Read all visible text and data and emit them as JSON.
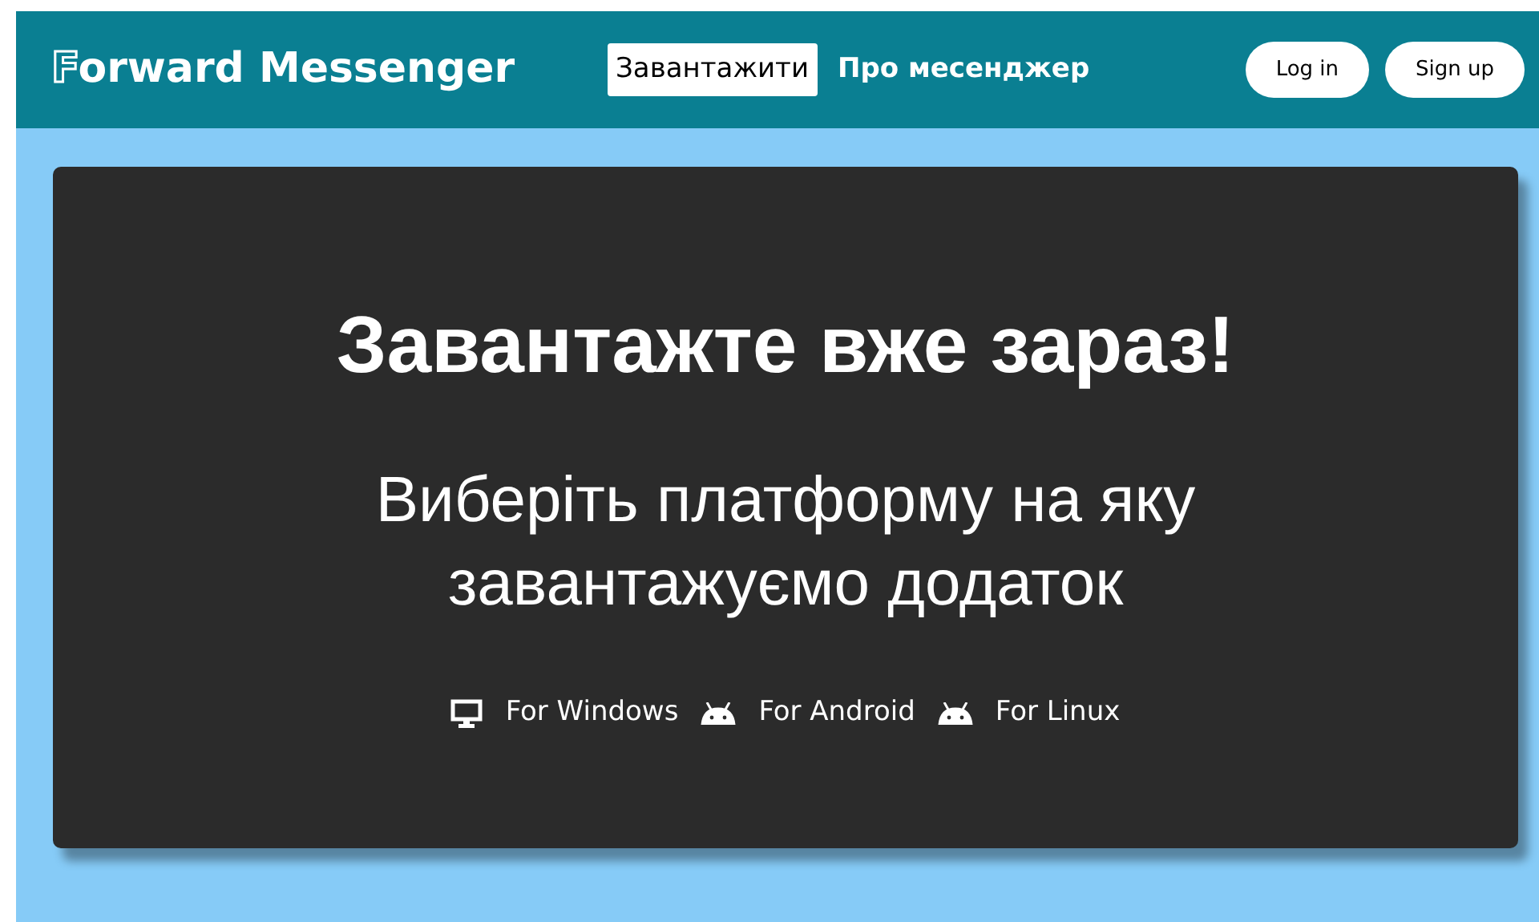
{
  "header": {
    "logo": "Forward Messenger",
    "nav": [
      {
        "label": "Завантажити",
        "selected": true
      },
      {
        "label": "Про месенджер",
        "selected": false
      }
    ],
    "buttons": [
      "Log in",
      "Sign up"
    ]
  },
  "hero": {
    "title": "Завантажте вже зараз!",
    "subtitle": "Виберіть платформу на яку завантажуємо додаток",
    "platforms": [
      {
        "kind": "desktop",
        "label": "For Windows"
      },
      {
        "kind": "android",
        "label": "For Android"
      },
      {
        "kind": "android",
        "label": "For Linux"
      }
    ]
  }
}
